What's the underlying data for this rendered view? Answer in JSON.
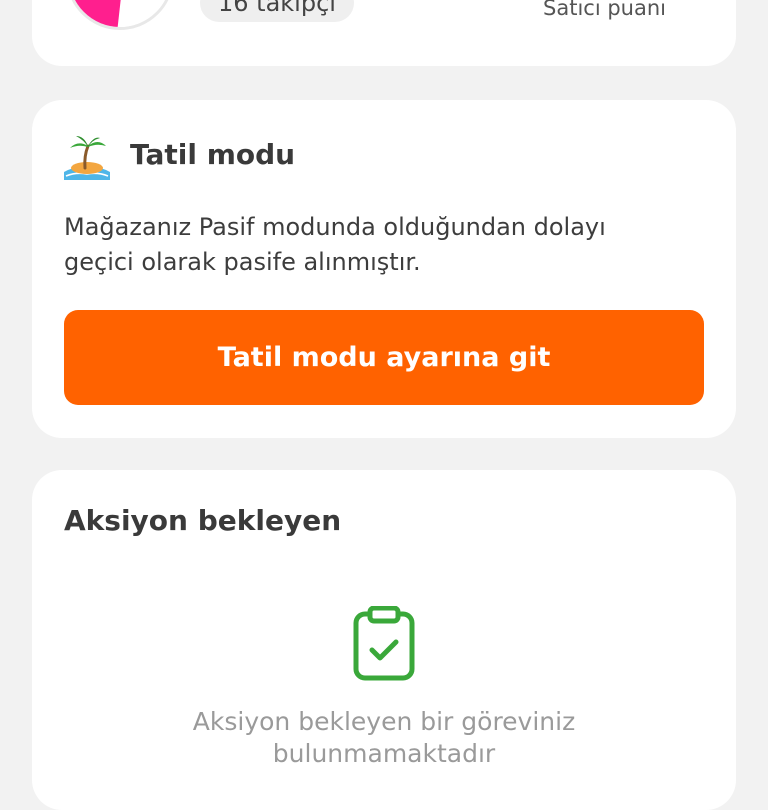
{
  "profile": {
    "followers": "16 takipçi",
    "seller_score_label": "Satıcı puanı"
  },
  "vacation": {
    "icon": "desert-island-icon",
    "title": "Tatil modu",
    "description_line1": "Mağazanız Pasif modunda olduğundan dolayı",
    "description_line2": "geçici olarak pasife alınmıştır.",
    "button_label": "Tatil modu ayarına git",
    "button_color": "#ff6200"
  },
  "pending": {
    "title": "Aksiyon bekleyen",
    "icon": "clipboard-check-icon",
    "icon_color": "#3aa83a",
    "empty_line1": "Aksiyon bekleyen bir göreviniz",
    "empty_line2": "bulunmamaktadır"
  }
}
